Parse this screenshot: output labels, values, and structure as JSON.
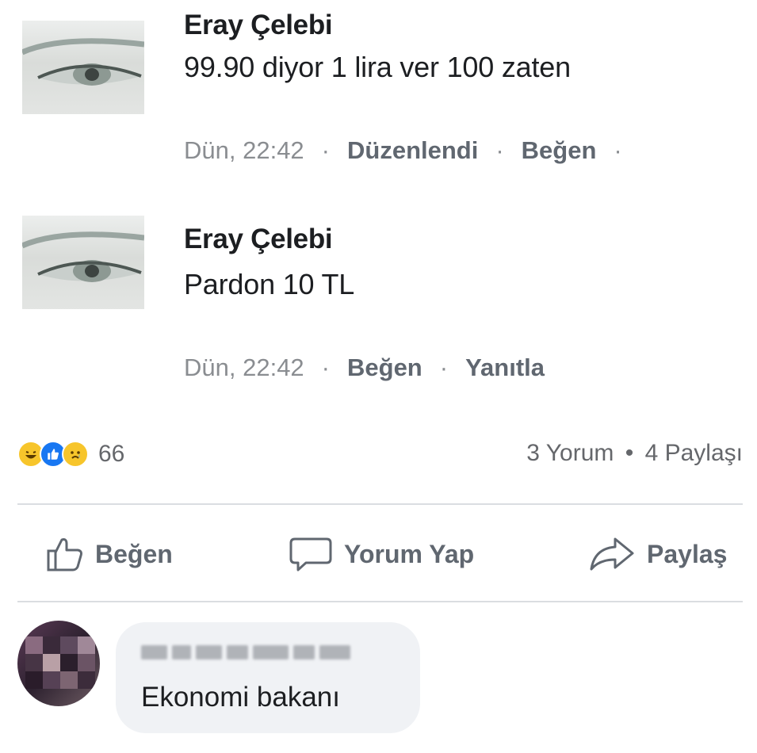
{
  "comments": [
    {
      "author": "Eray Çelebi",
      "text": "99.90 diyor 1 lira ver 100 zaten",
      "time": "Dün, 22:42",
      "edited": "Düzenlendi",
      "like": "Beğen"
    },
    {
      "author": "Eray Çelebi",
      "text": "Pardon 10 TL",
      "time": "Dün, 22:42",
      "like": "Beğen",
      "reply": "Yanıtla"
    }
  ],
  "reactions": {
    "icons": [
      "haha-icon",
      "like-icon",
      "sad-icon"
    ],
    "count": "66"
  },
  "stats": {
    "comments": "3 Yorum",
    "separator": "•",
    "shares": "4 Paylaşı"
  },
  "actions": {
    "like": "Beğen",
    "comment": "Yorum Yap",
    "share": "Paylaş"
  },
  "reply_comment": {
    "text": "Ekonomi bakanı"
  },
  "colors": {
    "text": "#1c1e21",
    "secondary": "#65676b",
    "divider": "#dadde1",
    "bubble": "#f0f2f5",
    "like_blue": "#1877f2"
  }
}
